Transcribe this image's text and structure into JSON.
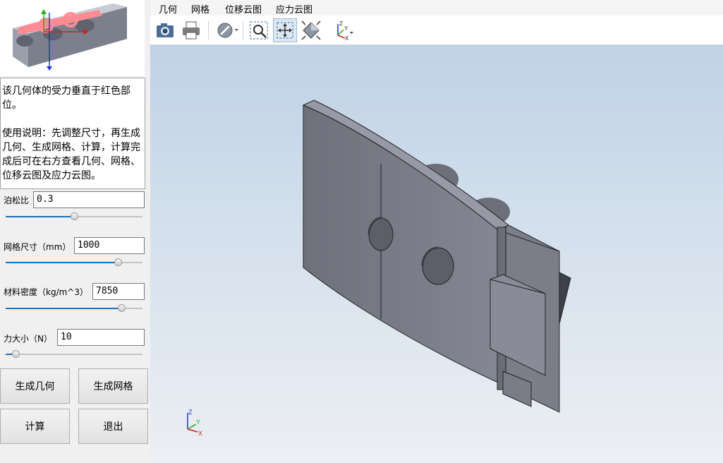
{
  "app": {
    "title": ""
  },
  "description": {
    "line1": "该几何体的受力垂直于红色部位。",
    "line2": "使用说明：先调整尺寸，再生成几何、生成网格、计算，计算完成后可在右方查看几何、网格、位移云图及应力云图。"
  },
  "params": [
    {
      "label": "泊松比",
      "value": "0.3",
      "slider_fraction": 0.5
    },
    {
      "label": "网格尺寸（mm）",
      "value": "1000",
      "slider_fraction": 0.84
    },
    {
      "label": "材料密度（kg/m^3）",
      "value": "7850",
      "slider_fraction": 0.87
    },
    {
      "label": "力大小（N）",
      "value": "10",
      "slider_fraction": 0.05
    }
  ],
  "buttons": {
    "generate_geometry": "生成几何",
    "generate_mesh": "生成网格",
    "compute": "计算",
    "exit": "退出"
  },
  "menu": [
    "几何",
    "网格",
    "位移云图",
    "应力云图"
  ],
  "toolbar": {
    "icons": [
      "camera-icon",
      "print-icon",
      "display-mode-icon",
      "zoom-window-icon",
      "pan-icon",
      "fit-all-icon",
      "axis-view-icon"
    ]
  },
  "axes": {
    "z": "Z",
    "y": "Y",
    "x": "X"
  },
  "colors": {
    "slider_fill": "#1f6fb5",
    "model_face": "#80818e",
    "highlight": "#ff8c94"
  }
}
